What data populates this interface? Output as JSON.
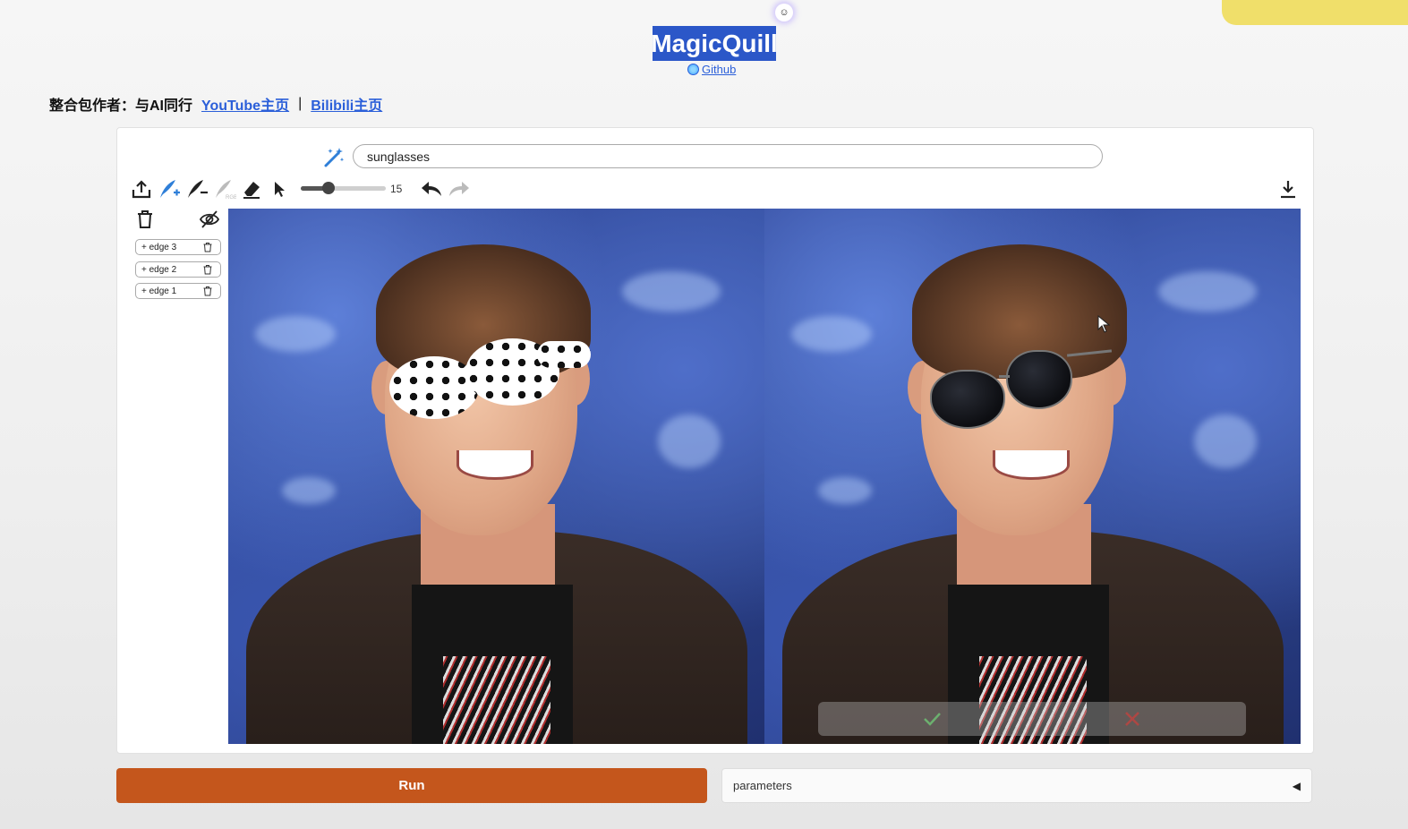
{
  "header": {
    "title": "MagicQuill",
    "github_label": "Github",
    "credit_label": "整合包作者：与AI同行",
    "youtube_label": "YouTube主页",
    "separator": "|",
    "bilibili_label": "Bilibili主页"
  },
  "prompt": {
    "value": "sunglasses"
  },
  "toolbar": {
    "brush_size": "15",
    "brush_size_fraction": 0.33
  },
  "layers": [
    {
      "label": "+ edge 3"
    },
    {
      "label": "+ edge 2"
    },
    {
      "label": "+ edge 1"
    }
  ],
  "footer": {
    "run_label": "Run",
    "parameters_label": "parameters",
    "parameters_arrow": "◀"
  },
  "colors": {
    "title_bg": "#2b57c8",
    "link": "#2b5fd9",
    "run_bg": "#c4561c",
    "top_tab": "#f0df6a"
  },
  "icons": [
    "upload-icon",
    "add-brush-icon",
    "subtract-brush-icon",
    "color-brush-icon",
    "eraser-icon",
    "pointer-icon",
    "undo-icon",
    "redo-icon",
    "download-icon",
    "trash-icon",
    "eye-off-icon",
    "magic-wand-icon",
    "check-icon",
    "close-icon",
    "globe-icon"
  ]
}
